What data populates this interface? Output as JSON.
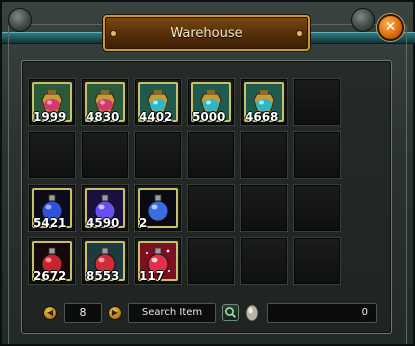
{
  "window": {
    "title": "Warehouse"
  },
  "close": {
    "glyph": "✕"
  },
  "slots": [
    {
      "row": 0,
      "col": 0,
      "item": "pink-bag",
      "qty": "1999"
    },
    {
      "row": 0,
      "col": 1,
      "item": "pink-bag",
      "qty": "4830"
    },
    {
      "row": 0,
      "col": 2,
      "item": "blue-bag",
      "qty": "4402"
    },
    {
      "row": 0,
      "col": 3,
      "item": "blue-bag",
      "qty": "5000"
    },
    {
      "row": 0,
      "col": 4,
      "item": "blue-bag",
      "qty": "4668"
    },
    {
      "row": 2,
      "col": 0,
      "item": "blue-potion",
      "qty": "5421"
    },
    {
      "row": 2,
      "col": 1,
      "item": "purple-potion",
      "qty": "4590"
    },
    {
      "row": 2,
      "col": 2,
      "item": "blue-flask",
      "qty": "2"
    },
    {
      "row": 3,
      "col": 0,
      "item": "red-potion",
      "qty": "2672"
    },
    {
      "row": 3,
      "col": 1,
      "item": "red-potion-light",
      "qty": "8553"
    },
    {
      "row": 3,
      "col": 2,
      "item": "red-sparkle-potion",
      "qty": "117"
    }
  ],
  "pager": {
    "value": "8",
    "prev_glyph": "◀",
    "next_glyph": "▶"
  },
  "search": {
    "label": "Search Item"
  },
  "gold": {
    "amount": "0"
  },
  "colors": {
    "title_plate": "#5a3209",
    "slot_border": "#c9c06a",
    "accent_teal": "#2e7a82"
  }
}
